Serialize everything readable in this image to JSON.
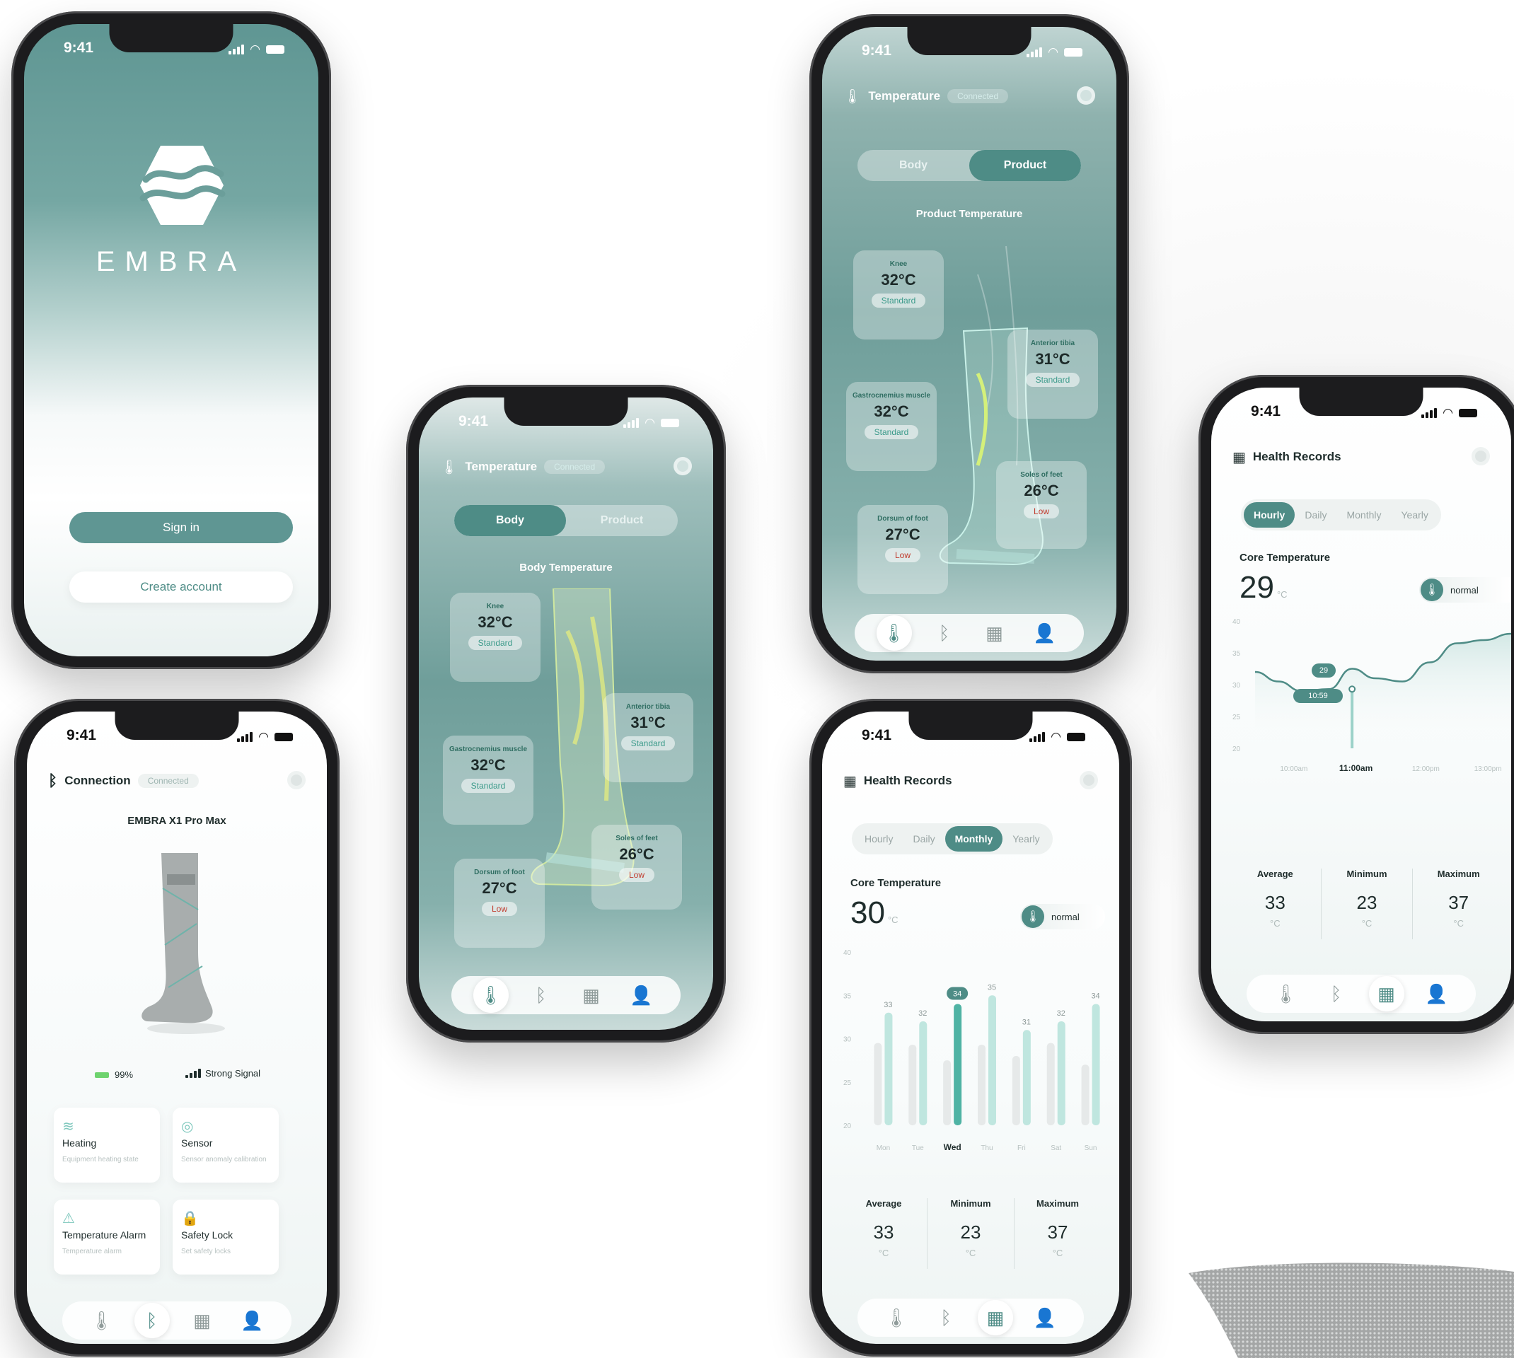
{
  "status": {
    "time": "9:41"
  },
  "splash": {
    "brand": "EMBRA",
    "sign_in": "Sign in",
    "create_account": "Create account"
  },
  "connection": {
    "title": "Connection",
    "status": "Connected",
    "device": "EMBRA X1 Pro Max",
    "battery": "99%",
    "signal": "Strong Signal",
    "features": [
      {
        "icon": "heat-waves-icon",
        "title": "Heating",
        "desc": "Equipment heating state"
      },
      {
        "icon": "sensor-icon",
        "title": "Sensor",
        "desc": "Sensor anomaly calibration"
      },
      {
        "icon": "alarm-icon",
        "title": "Temperature Alarm",
        "desc": "Temperature alarm"
      },
      {
        "icon": "lock-icon",
        "title": "Safety Lock",
        "desc": "Set safety locks"
      }
    ]
  },
  "body_temp": {
    "title": "Temperature",
    "status": "Connected",
    "tab_body": "Body",
    "tab_product": "Product",
    "subtitle": "Body Temperature",
    "cards": [
      {
        "name": "Knee",
        "value": "32°C",
        "state": "Standard"
      },
      {
        "name": "Anterior tibia",
        "value": "31°C",
        "state": "Standard"
      },
      {
        "name": "Gastrocnemius muscle",
        "value": "32°C",
        "state": "Standard"
      },
      {
        "name": "Soles of feet",
        "value": "26°C",
        "state": "Low"
      },
      {
        "name": "Dorsum of foot",
        "value": "27°C",
        "state": "Low"
      }
    ]
  },
  "product_temp": {
    "title": "Temperature",
    "status": "Connected",
    "tab_body": "Body",
    "tab_product": "Product",
    "subtitle": "Product Temperature",
    "cards": [
      {
        "name": "Knee",
        "value": "32°C",
        "state": "Standard"
      },
      {
        "name": "Anterior tibia",
        "value": "31°C",
        "state": "Standard"
      },
      {
        "name": "Gastrocnemius muscle",
        "value": "32°C",
        "state": "Standard"
      },
      {
        "name": "Soles of feet",
        "value": "26°C",
        "state": "Low"
      },
      {
        "name": "Dorsum of foot",
        "value": "27°C",
        "state": "Low"
      }
    ]
  },
  "records_monthly": {
    "title": "Health Records",
    "tabs": [
      "Hourly",
      "Daily",
      "Monthly",
      "Yearly"
    ],
    "active_tab": "Monthly",
    "core_label": "Core Temperature",
    "core_value": "30",
    "unit": "°C",
    "badge": "normal",
    "stats": [
      {
        "label": "Average",
        "value": "33",
        "unit": "°C"
      },
      {
        "label": "Minimum",
        "value": "23",
        "unit": "°C"
      },
      {
        "label": "Maximum",
        "value": "37",
        "unit": "°C"
      }
    ]
  },
  "records_hourly": {
    "title": "Health Records",
    "tabs": [
      "Hourly",
      "Daily",
      "Monthly",
      "Yearly"
    ],
    "active_tab": "Hourly",
    "core_label": "Core Temperature",
    "core_value": "29",
    "unit": "°C",
    "badge": "normal",
    "tooltip_value": "29",
    "tooltip_time": "10:59",
    "stats": [
      {
        "label": "Average",
        "value": "33",
        "unit": "°C"
      },
      {
        "label": "Minimum",
        "value": "23",
        "unit": "°C"
      },
      {
        "label": "Maximum",
        "value": "37",
        "unit": "°C"
      }
    ]
  },
  "chart_data": [
    {
      "type": "bar",
      "categories": [
        "Mon",
        "Tue",
        "Wed",
        "Thu",
        "Fri",
        "Sat",
        "Sun"
      ],
      "highlight": "Wed",
      "y_ticks": [
        40,
        35,
        30,
        25,
        20
      ],
      "ylim": [
        20,
        40
      ],
      "series": [
        {
          "values": [
            29,
            33,
            32,
            34,
            35,
            31,
            32,
            34
          ]
        }
      ],
      "bar_labels": [
        {
          "category": "Mon",
          "value": 33
        },
        {
          "category": "Tue",
          "value": 32
        },
        {
          "category": "Wed",
          "value": 34
        },
        {
          "category": "Thu",
          "value": 35
        },
        {
          "category": "Fri",
          "value": 31
        },
        {
          "category": "Sat",
          "value": 32
        },
        {
          "category": "Sun",
          "value": 34
        }
      ],
      "pairs": [
        {
          "category": "Mon",
          "gray": 29.5,
          "teal": 33
        },
        {
          "category": "Tue",
          "gray": 29.3,
          "teal": 32
        },
        {
          "category": "Wed",
          "gray": 27.5,
          "teal": 34
        },
        {
          "category": "Thu",
          "gray": 29.3,
          "teal": 35
        },
        {
          "category": "Fri",
          "gray": 28,
          "teal": 31
        },
        {
          "category": "Sat",
          "gray": 29.5,
          "teal": 32
        },
        {
          "category": "Sun",
          "gray": 27,
          "teal": 34
        }
      ]
    },
    {
      "type": "area",
      "x_labels": [
        "10:00am",
        "11:00am",
        "12:00pm",
        "13:00pm"
      ],
      "highlight": "11:00am",
      "y_ticks": [
        40,
        35,
        30,
        25,
        20
      ],
      "ylim": [
        20,
        40
      ],
      "x": [
        0,
        0.3,
        0.6,
        0.95,
        1.25,
        1.55,
        1.9,
        2.25,
        2.6,
        2.95,
        3.3
      ],
      "y": [
        32,
        30.5,
        29,
        29.3,
        32.5,
        31,
        30.5,
        33.5,
        36.5,
        37,
        38
      ]
    }
  ]
}
